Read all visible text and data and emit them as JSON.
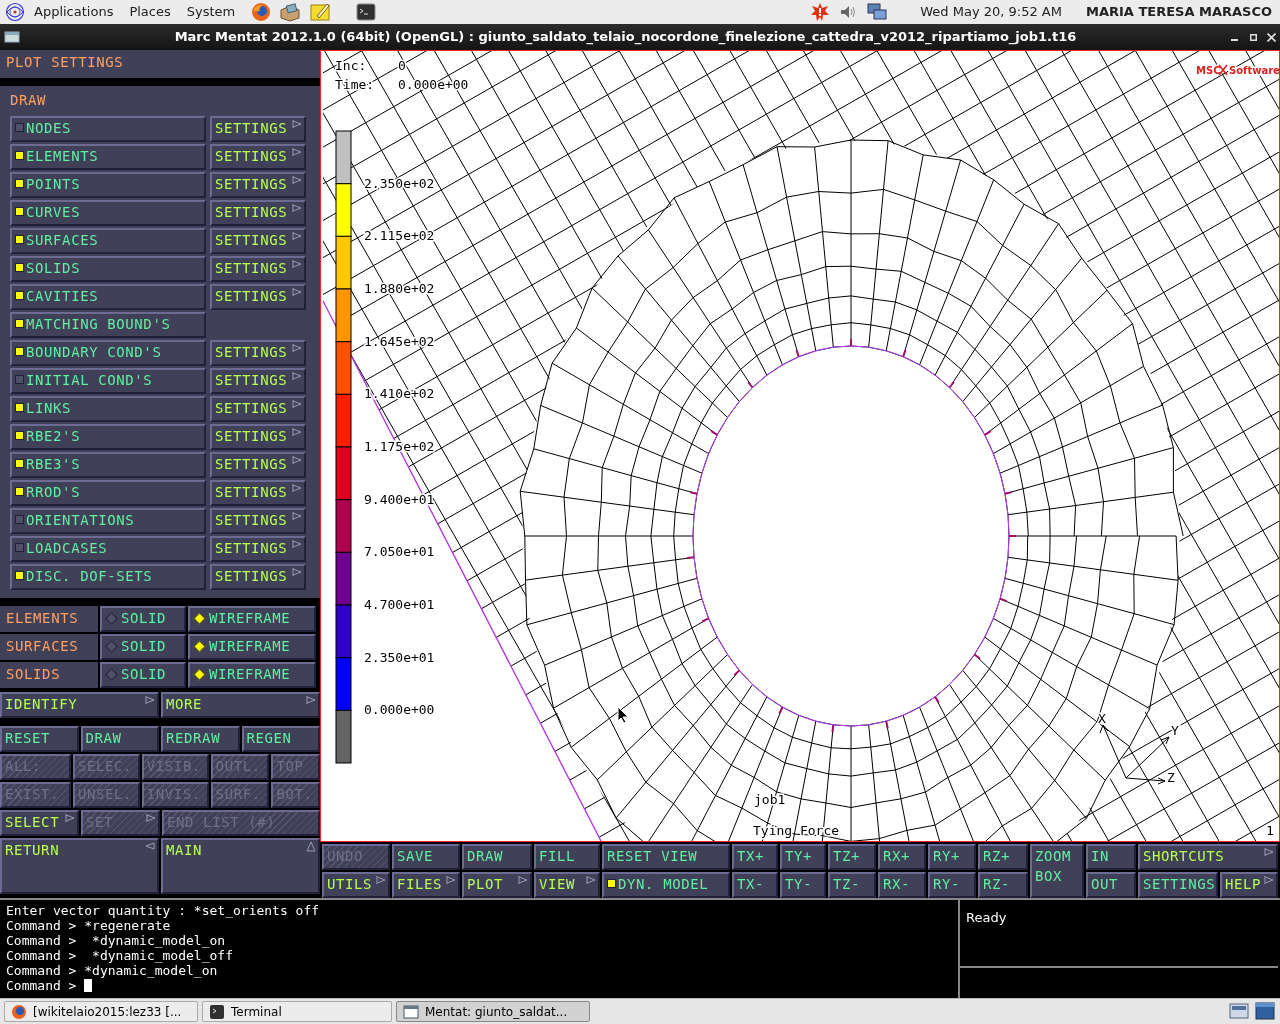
{
  "top_panel": {
    "menus": [
      "Applications",
      "Places",
      "System"
    ],
    "clock": "Wed May 20,  9:52 AM",
    "user": "MARIA TERESA MARASCO"
  },
  "window": {
    "title": "Marc Mentat 2012.1.0 (64bit) (OpenGL) : giunto_saldato_telaio_nocordone_finelezione_cattedra_v2012_ripartiamo_job1.t16"
  },
  "plot_settings": {
    "title": "PLOT SETTINGS",
    "section": "DRAW",
    "draw_items": [
      {
        "label": "NODES",
        "checked": false,
        "settings": "SETTINGS"
      },
      {
        "label": "ELEMENTS",
        "checked": true,
        "settings": "SETTINGS"
      },
      {
        "label": "POINTS",
        "checked": true,
        "settings": "SETTINGS"
      },
      {
        "label": "CURVES",
        "checked": true,
        "settings": "SETTINGS"
      },
      {
        "label": "SURFACES",
        "checked": true,
        "settings": "SETTINGS"
      },
      {
        "label": "SOLIDS",
        "checked": true,
        "settings": "SETTINGS"
      },
      {
        "label": "CAVITIES",
        "checked": true,
        "settings": "SETTINGS"
      },
      {
        "label": "MATCHING BOUND'S",
        "checked": true
      },
      {
        "label": "BOUNDARY COND'S",
        "checked": true,
        "settings": "SETTINGS"
      },
      {
        "label": "INITIAL COND'S",
        "checked": false,
        "settings": "SETTINGS"
      },
      {
        "label": "LINKS",
        "checked": true,
        "settings": "SETTINGS"
      },
      {
        "label": "RBE2'S",
        "checked": true,
        "settings": "SETTINGS"
      },
      {
        "label": "RBE3'S",
        "checked": true,
        "settings": "SETTINGS"
      },
      {
        "label": "RROD'S",
        "checked": true,
        "settings": "SETTINGS"
      },
      {
        "label": "ORIENTATIONS",
        "checked": false,
        "settings": "SETTINGS"
      },
      {
        "label": "LOADCASES",
        "checked": false,
        "settings": "SETTINGS"
      },
      {
        "label": "DISC. DOF-SETS",
        "checked": true,
        "settings": "SETTINGS"
      }
    ],
    "render_modes": [
      {
        "label": "ELEMENTS",
        "options": [
          {
            "label": "SOLID",
            "selected": false
          },
          {
            "label": "WIREFRAME",
            "selected": true
          }
        ]
      },
      {
        "label": "SURFACES",
        "options": [
          {
            "label": "SOLID",
            "selected": false
          },
          {
            "label": "WIREFRAME",
            "selected": true
          }
        ]
      },
      {
        "label": "SOLIDS",
        "options": [
          {
            "label": "SOLID",
            "selected": false
          },
          {
            "label": "WIREFRAME",
            "selected": true
          }
        ]
      }
    ],
    "more_row": [
      {
        "label": "IDENTIFY",
        "kind": "menu",
        "disabled": false
      },
      {
        "label": "MORE",
        "kind": "menu",
        "disabled": false
      }
    ],
    "command_rows": [
      [
        {
          "label": "RESET",
          "kind": "action",
          "disabled": false
        },
        {
          "label": "DRAW",
          "kind": "action",
          "disabled": false
        },
        {
          "label": "REDRAW",
          "kind": "action",
          "disabled": false
        },
        {
          "label": "REGEN",
          "kind": "action",
          "disabled": false
        }
      ],
      [
        {
          "label": "ALL:",
          "kind": "action",
          "disabled": true
        },
        {
          "label": "SELEC.",
          "kind": "action",
          "disabled": true
        },
        {
          "label": "VISIB.",
          "kind": "action",
          "disabled": true
        },
        {
          "label": "OUTL.",
          "kind": "action",
          "disabled": true
        },
        {
          "label": "TOP",
          "kind": "action",
          "disabled": true
        }
      ],
      [
        {
          "label": "EXIST.",
          "kind": "action",
          "disabled": true
        },
        {
          "label": "UNSEL.",
          "kind": "action",
          "disabled": true
        },
        {
          "label": "INVIS.",
          "kind": "action",
          "disabled": true
        },
        {
          "label": "SURF.",
          "kind": "action",
          "disabled": true
        },
        {
          "label": "BOT.",
          "kind": "action",
          "disabled": true
        }
      ],
      [
        {
          "label": "SELECT",
          "kind": "menu",
          "disabled": false
        },
        {
          "label": "SET",
          "kind": "menu",
          "disabled": true
        },
        {
          "label": "END LIST (#)",
          "kind": "action",
          "disabled": true
        }
      ],
      [
        {
          "label": "RETURN",
          "kind": "back",
          "disabled": false
        },
        {
          "label": "MAIN",
          "kind": "up",
          "disabled": false
        }
      ]
    ]
  },
  "viewport": {
    "inc_label": "Inc:",
    "inc": "0",
    "time_label": "Time:",
    "time": "0.000e+00",
    "logo_brand": "MSC",
    "logo_name": "Software",
    "legend": {
      "bands": [
        {
          "color": "#c0c0c0"
        },
        {
          "color": "#ffff00"
        },
        {
          "color": "#ffc800"
        },
        {
          "color": "#ff9600"
        },
        {
          "color": "#ff5000"
        },
        {
          "color": "#ff1e00"
        },
        {
          "color": "#e00020"
        },
        {
          "color": "#b00050"
        },
        {
          "color": "#700090"
        },
        {
          "color": "#3000c8"
        },
        {
          "color": "#0000ff"
        },
        {
          "color": "#646464"
        }
      ],
      "labels": [
        "2.350e+02",
        "2.115e+02",
        "1.880e+02",
        "1.645e+02",
        "1.410e+02",
        "1.175e+02",
        "9.400e+01",
        "7.050e+01",
        "4.700e+01",
        "2.350e+01",
        "0.000e+00"
      ]
    },
    "job": "job1",
    "quantity": "Tying Force",
    "corner": "1",
    "axes": [
      "X",
      "Y",
      "Z"
    ]
  },
  "toolbar": [
    [
      [
        {
          "label": "UNDO",
          "kind": "action",
          "disabled": true
        }
      ],
      [
        {
          "label": "UTILS",
          "kind": "menu"
        }
      ]
    ],
    [
      [
        {
          "label": "SAVE",
          "kind": "action"
        }
      ],
      [
        {
          "label": "FILES",
          "kind": "menu"
        }
      ]
    ],
    [
      [
        {
          "label": "DRAW",
          "kind": "action"
        }
      ],
      [
        {
          "label": "PLOT",
          "kind": "menu"
        }
      ]
    ],
    [
      [
        {
          "label": "FILL",
          "kind": "action"
        }
      ],
      [
        {
          "label": "VIEW",
          "kind": "menu"
        }
      ]
    ],
    [
      [
        {
          "label": "RESET VIEW",
          "kind": "action"
        }
      ],
      [
        {
          "label": "DYN. MODEL",
          "kind": "toggle",
          "checked": true
        }
      ]
    ],
    [
      [
        {
          "label": "TX+",
          "kind": "action"
        }
      ],
      [
        {
          "label": "TX-",
          "kind": "action"
        }
      ]
    ],
    [
      [
        {
          "label": "TY+",
          "kind": "action"
        }
      ],
      [
        {
          "label": "TY-",
          "kind": "action"
        }
      ]
    ],
    [
      [
        {
          "label": "TZ+",
          "kind": "action"
        }
      ],
      [
        {
          "label": "TZ-",
          "kind": "action"
        }
      ]
    ],
    [
      [
        {
          "label": "RX+",
          "kind": "action"
        }
      ],
      [
        {
          "label": "RX-",
          "kind": "action"
        }
      ]
    ],
    [
      [
        {
          "label": "RY+",
          "kind": "action"
        }
      ],
      [
        {
          "label": "RY-",
          "kind": "action"
        }
      ]
    ],
    [
      [
        {
          "label": "RZ+",
          "kind": "action"
        }
      ],
      [
        {
          "label": "RZ-",
          "kind": "action"
        }
      ]
    ],
    [
      [
        {
          "label": "ZOOM BOX",
          "kind": "action"
        }
      ]
    ],
    [
      [
        {
          "label": "IN",
          "kind": "action"
        }
      ],
      [
        {
          "label": "OUT",
          "kind": "action"
        }
      ]
    ],
    [
      [
        {
          "label": "SHORTCUTS",
          "kind": "menu"
        }
      ],
      [
        {
          "label": "SETTINGS",
          "kind": "action"
        },
        {
          "label": "HELP",
          "kind": "menu"
        }
      ]
    ]
  ],
  "console": {
    "lines": [
      "Enter vector quantity : *set_orients off",
      "Command > *regenerate",
      "Command >  *dynamic_model_on",
      "Command >  *dynamic_model_off",
      "Command > *dynamic_model_on",
      "Command > "
    ],
    "status": "Ready"
  },
  "taskbar": [
    {
      "label": "[wikitelaio2015:lez33 [...",
      "kind": "browser",
      "selected": false
    },
    {
      "label": "Terminal",
      "kind": "terminal",
      "selected": false
    },
    {
      "label": "Mentat: giunto_saldat...",
      "kind": "window",
      "selected": true
    }
  ]
}
